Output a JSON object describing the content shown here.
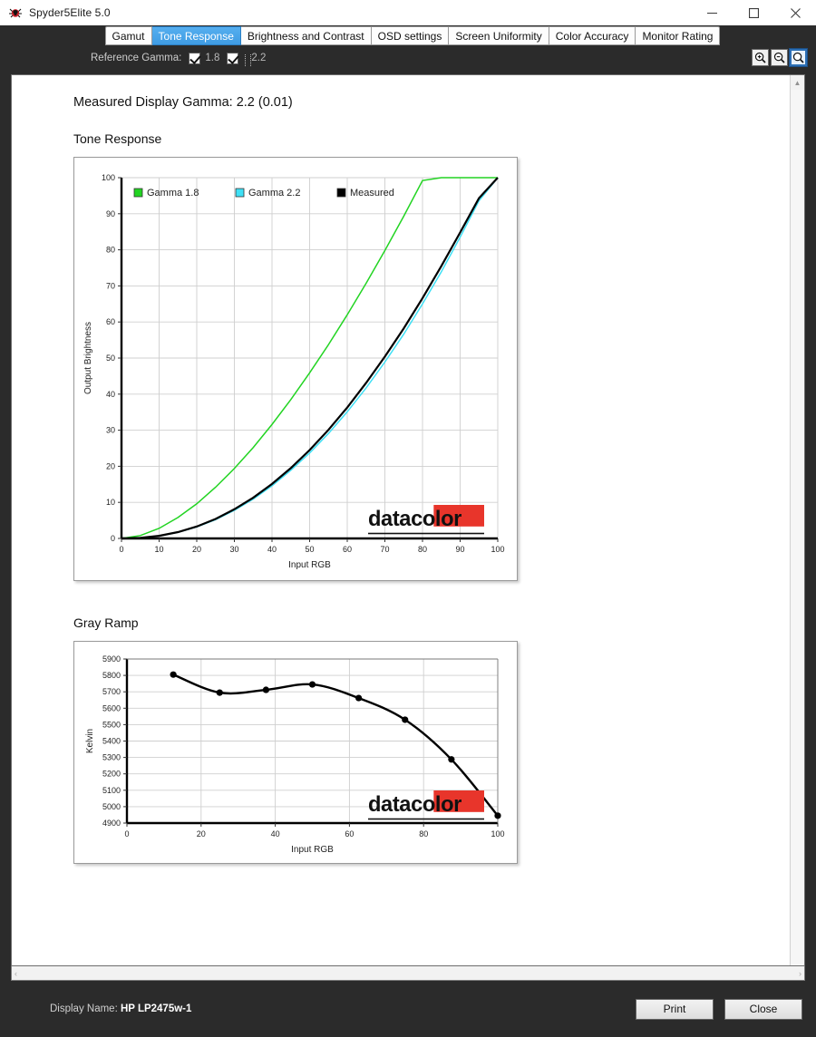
{
  "window": {
    "title": "Spyder5Elite 5.0",
    "icon": "spider-icon",
    "minimize_label": "–",
    "maximize_label": "□",
    "close_label": "✕"
  },
  "tabs": [
    {
      "label": "Gamut",
      "active": false
    },
    {
      "label": "Tone Response",
      "active": true
    },
    {
      "label": "Brightness and Contrast",
      "active": false
    },
    {
      "label": "OSD settings",
      "active": false
    },
    {
      "label": "Screen Uniformity",
      "active": false
    },
    {
      "label": "Color Accuracy",
      "active": false
    },
    {
      "label": "Monitor Rating",
      "active": false
    }
  ],
  "toolbar": {
    "reference_gamma_label": "Reference Gamma:",
    "gamma_1_8_value": "1.8",
    "gamma_1_8_checked": true,
    "gamma_2_2_value": "2.2",
    "gamma_2_2_checked": true,
    "zoom_in": "zoom-in-icon",
    "zoom_out": "zoom-out-icon",
    "zoom_reset": "zoom-reset-icon"
  },
  "report": {
    "measured_gamma_line": "Measured Display Gamma: 2.2 (0.01)",
    "tone_response_title": "Tone Response",
    "gray_ramp_title": "Gray Ramp",
    "logo_text": "datacolor",
    "logo_bar_color": "#e8352b"
  },
  "scrollbars": {
    "v_up": "▲",
    "h_left": "‹",
    "h_right": "›"
  },
  "footer": {
    "display_name_label": "Display Name:",
    "display_name_value": "HP LP2475w-1",
    "print_label": "Print",
    "close_label": "Close"
  },
  "chart_data": [
    {
      "type": "line",
      "id": "tone-response",
      "title": "Tone Response",
      "xlabel": "Input RGB",
      "ylabel": "Output Brightness",
      "xlim": [
        0,
        100
      ],
      "ylim": [
        0,
        100
      ],
      "xticks": [
        0,
        10,
        20,
        30,
        40,
        50,
        60,
        70,
        80,
        90,
        100
      ],
      "yticks": [
        0,
        10,
        20,
        30,
        40,
        50,
        60,
        70,
        80,
        90,
        100
      ],
      "grid": true,
      "legend_position": "top-left",
      "series": [
        {
          "name": "Gamma 1.8",
          "color": "#22d422",
          "x": [
            0,
            5,
            10,
            15,
            20,
            25,
            30,
            35,
            40,
            45,
            50,
            55,
            60,
            65,
            70,
            75,
            80,
            85,
            90,
            95,
            100
          ],
          "values": [
            0,
            0.8,
            2.8,
            5.8,
            9.6,
            14.2,
            19.4,
            25.2,
            31.6,
            38.5,
            45.9,
            53.7,
            62.0,
            70.7,
            79.8,
            89.3,
            99.2,
            100,
            100,
            100,
            100
          ]
        },
        {
          "name": "Gamma 2.2",
          "color": "#3fe0f5",
          "x": [
            0,
            5,
            10,
            15,
            20,
            25,
            30,
            35,
            40,
            45,
            50,
            55,
            60,
            65,
            70,
            75,
            80,
            85,
            90,
            95,
            100
          ],
          "values": [
            0,
            0.15,
            0.69,
            1.7,
            3.2,
            5.2,
            7.8,
            10.9,
            14.6,
            18.9,
            23.7,
            29.1,
            35.1,
            41.7,
            48.9,
            56.6,
            65.0,
            73.9,
            83.5,
            93.6,
            100
          ]
        },
        {
          "name": "Measured",
          "color": "#000000",
          "x": [
            0,
            5,
            10,
            15,
            20,
            25,
            30,
            35,
            40,
            45,
            50,
            55,
            60,
            65,
            70,
            75,
            80,
            85,
            90,
            95,
            100
          ],
          "values": [
            0,
            0.16,
            0.72,
            1.76,
            3.3,
            5.4,
            8.1,
            11.3,
            15.1,
            19.5,
            24.5,
            30.1,
            36.3,
            43.1,
            50.4,
            58.2,
            66.6,
            75.5,
            84.8,
            94.3,
            100
          ]
        }
      ]
    },
    {
      "type": "line",
      "id": "gray-ramp",
      "title": "Gray Ramp",
      "xlabel": "Input RGB",
      "ylabel": "Kelvin",
      "xlim": [
        0,
        100
      ],
      "ylim": [
        4900,
        5900
      ],
      "xticks": [
        0,
        20,
        40,
        60,
        80,
        100
      ],
      "yticks": [
        4900,
        5000,
        5100,
        5200,
        5300,
        5400,
        5500,
        5600,
        5700,
        5800,
        5900
      ],
      "grid": true,
      "marker": "circle",
      "color": "#000000",
      "x": [
        12.5,
        25,
        37.5,
        50,
        62.5,
        75,
        87.5,
        100
      ],
      "values": [
        5805,
        5695,
        5712,
        5745,
        5662,
        5530,
        5288,
        4945
      ]
    }
  ]
}
